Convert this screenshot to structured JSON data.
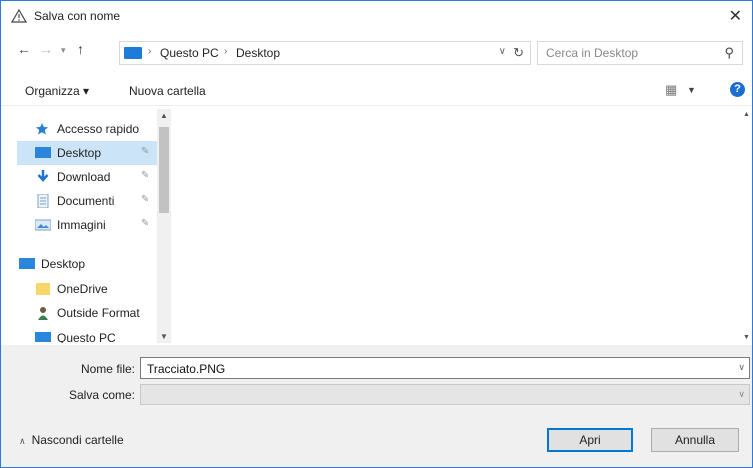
{
  "window": {
    "title": "Salva con nome",
    "close_glyph": "✕"
  },
  "address": {
    "crumbs": [
      "Questo PC",
      "Desktop"
    ],
    "search_placeholder": "Cerca in Desktop"
  },
  "toolbar": {
    "organize_label": "Organizza ▾",
    "new_folder_label": "Nuova cartella"
  },
  "nav": {
    "items": [
      {
        "label": "Accesso rapido",
        "icon": "star-icon"
      },
      {
        "label": "Desktop",
        "icon": "desktop-icon",
        "pinned": true,
        "selected": true
      },
      {
        "label": "Download",
        "icon": "download-icon",
        "pinned": true
      },
      {
        "label": "Documenti",
        "icon": "documents-icon",
        "pinned": true
      },
      {
        "label": "Immagini",
        "icon": "pictures-icon",
        "pinned": true
      },
      {
        "label": "Desktop",
        "icon": "desktop-icon"
      },
      {
        "label": "OneDrive",
        "icon": "folder-icon"
      },
      {
        "label": "Outside Format",
        "icon": "user-icon"
      },
      {
        "label": "Questo PC",
        "icon": "pc-icon"
      }
    ]
  },
  "form": {
    "filename_label": "Nome file:",
    "filename_value": "Tracciato.PNG",
    "savetype_label": "Salva come:",
    "savetype_value": ""
  },
  "footer": {
    "hide_folders_label": "Nascondi cartelle",
    "open_label": "Apri",
    "cancel_label": "Annulla"
  },
  "colors": {
    "accent": "#0078d7",
    "selected_bg": "#cce4f7",
    "window_border": "#2b79d8"
  }
}
